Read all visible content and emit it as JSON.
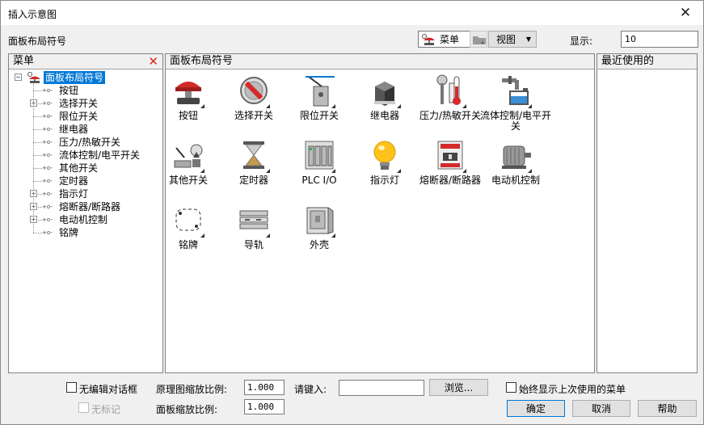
{
  "window": {
    "title": "插入示意图",
    "close_glyph": "✕"
  },
  "header": {
    "label": "面板布局符号",
    "menu_combo": "菜单",
    "view_button": "视图",
    "display_label": "显示:",
    "display_value": "10"
  },
  "tree": {
    "title": "菜单",
    "root": "面板布局符号",
    "items": [
      {
        "label": "按钮",
        "expandable": false
      },
      {
        "label": "选择开关",
        "expandable": true
      },
      {
        "label": "限位开关",
        "expandable": false
      },
      {
        "label": "继电器",
        "expandable": false
      },
      {
        "label": "压力/热敏开关",
        "expandable": false
      },
      {
        "label": "流体控制/电平开关",
        "expandable": false
      },
      {
        "label": "其他开关",
        "expandable": false
      },
      {
        "label": "定时器",
        "expandable": false
      },
      {
        "label": "指示灯",
        "expandable": true
      },
      {
        "label": "熔断器/断路器",
        "expandable": true
      },
      {
        "label": "电动机控制",
        "expandable": true
      },
      {
        "label": "铭牌",
        "expandable": false
      }
    ]
  },
  "center": {
    "title": "面板布局符号",
    "tiles": [
      {
        "label": "按钮",
        "icon": "pushbutton-icon"
      },
      {
        "label": "选择开关",
        "icon": "selector-switch-icon"
      },
      {
        "label": "限位开关",
        "icon": "limit-switch-icon"
      },
      {
        "label": "继电器",
        "icon": "relay-icon"
      },
      {
        "label": "压力/热敏开关",
        "icon": "pressure-thermal-switch-icon"
      },
      {
        "label": "流体控制/电平开关",
        "icon": "fluid-level-switch-icon"
      },
      {
        "label": "其他开关",
        "icon": "other-switch-icon"
      },
      {
        "label": "定时器",
        "icon": "timer-icon"
      },
      {
        "label": "PLC I/O",
        "icon": "plc-io-icon"
      },
      {
        "label": "指示灯",
        "icon": "pilot-light-icon"
      },
      {
        "label": "熔断器/断路器",
        "icon": "fuse-breaker-icon"
      },
      {
        "label": "电动机控制",
        "icon": "motor-control-icon"
      },
      {
        "label": "铭牌",
        "icon": "nameplate-icon"
      },
      {
        "label": "导轨",
        "icon": "din-rail-icon"
      },
      {
        "label": "外壳",
        "icon": "enclosure-icon"
      }
    ]
  },
  "recent": {
    "title": "最近使用的"
  },
  "footer": {
    "no_edit_dialog": "无编辑对话框",
    "no_tag": "无标记",
    "schematic_scale_label": "原理图缩放比例:",
    "schematic_scale_value": "1.000",
    "panel_scale_label": "面板缩放比例:",
    "panel_scale_value": "1.000",
    "type_label": "请键入:",
    "type_value": "",
    "browse_button": "浏览...",
    "always_show_last": "始终显示上次使用的菜单",
    "ok_button": "确定",
    "cancel_button": "取消",
    "help_button": "帮助"
  },
  "colors": {
    "selection": "#0078d7",
    "clear_icon": "#e0231b"
  }
}
